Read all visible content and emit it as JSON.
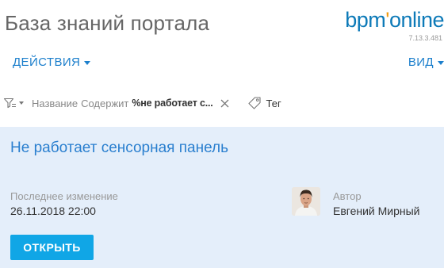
{
  "header": {
    "page_title": "База знаний портала",
    "logo": {
      "main": "bpm",
      "dot": "'",
      "rest": "online"
    },
    "version": "7.13.3.481"
  },
  "toolbar": {
    "actions_label": "ДЕЙСТВИЯ",
    "view_label": "ВИД"
  },
  "filter": {
    "field": "Название",
    "operator": "Содержит",
    "value": "%не работает с...",
    "tag_label": "Тег"
  },
  "record": {
    "title": "Не работает сенсорная панель",
    "modified_caption": "Последнее изменение",
    "modified_value": "26.11.2018 22:00",
    "author_caption": "Автор",
    "author_value": "Евгений Мирный",
    "open_label": "ОТКРЫТЬ"
  },
  "colors": {
    "accent": "#1c7fcc",
    "panel_background": "#e4eefa",
    "button_background": "#10a6e6",
    "logo_blue": "#0d7ab8",
    "logo_orange": "#f39c12"
  },
  "icons": [
    "filter-icon",
    "caret-down-icon",
    "close-icon",
    "tag-icon",
    "avatar"
  ]
}
